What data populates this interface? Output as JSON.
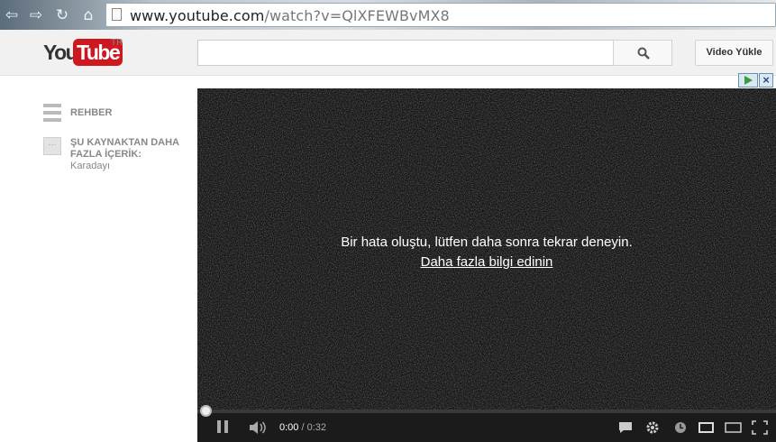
{
  "browser": {
    "url_host": "www.youtube.com",
    "url_path": "/watch?v=QlXFEWBvMX8",
    "nav": {
      "back": "⇦",
      "forward": "⇨",
      "reload": "↻",
      "home": "⌂"
    }
  },
  "header": {
    "logo_you": "You",
    "logo_tube": "Tube",
    "region": "TR",
    "search_placeholder": "",
    "upload_label": "Video Yükle"
  },
  "sidebar": {
    "guide_label": "REHBER",
    "source_title": "ŞU KAYNAKTAN DAHA FAZLA İÇERİK:",
    "source_channel": "Karadayı",
    "source_icon_text": "···"
  },
  "player": {
    "error_message": "Bir hata oluştu, lütfen daha sonra tekrar deneyin.",
    "error_link": "Daha fazla bilgi edinin",
    "time_current": "0:00",
    "time_sep": " / ",
    "time_total": "0:32",
    "progress": 0
  },
  "colors": {
    "brand_red": "#cc181e",
    "player_bg": "#161616"
  }
}
